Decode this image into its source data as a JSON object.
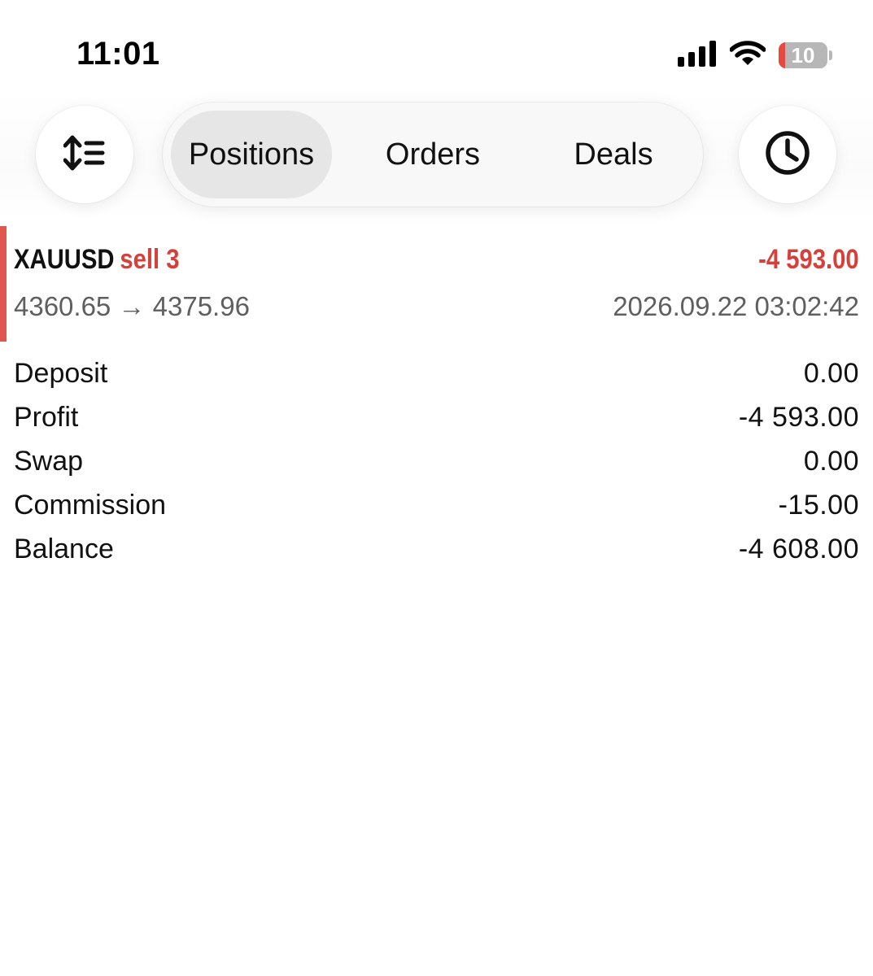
{
  "status_bar": {
    "time": "11:01",
    "battery_level": "10",
    "icons": [
      "cellular-signal-icon",
      "wifi-icon",
      "battery-icon"
    ],
    "battery_low_color": "#e8493e"
  },
  "toolbar": {
    "sort_icon": "sort-icon",
    "history_icon": "clock-icon",
    "tabs": [
      {
        "label": "Positions",
        "active": true
      },
      {
        "label": "Orders",
        "active": false
      },
      {
        "label": "Deals",
        "active": false
      }
    ]
  },
  "position": {
    "symbol": "XAUUSD",
    "side": "sell 3",
    "profit": "-4 593.00",
    "open_price": "4360.65",
    "arrow": "→",
    "current_price": "4375.96",
    "time": "2026.09.22 03:02:42",
    "accent_color": "#e0574d",
    "loss_color": "#d6403a"
  },
  "summary": [
    {
      "label": "Deposit",
      "value": "0.00"
    },
    {
      "label": "Profit",
      "value": "-4 593.00"
    },
    {
      "label": "Swap",
      "value": "0.00"
    },
    {
      "label": "Commission",
      "value": "-15.00"
    },
    {
      "label": "Balance",
      "value": "-4 608.00"
    }
  ]
}
